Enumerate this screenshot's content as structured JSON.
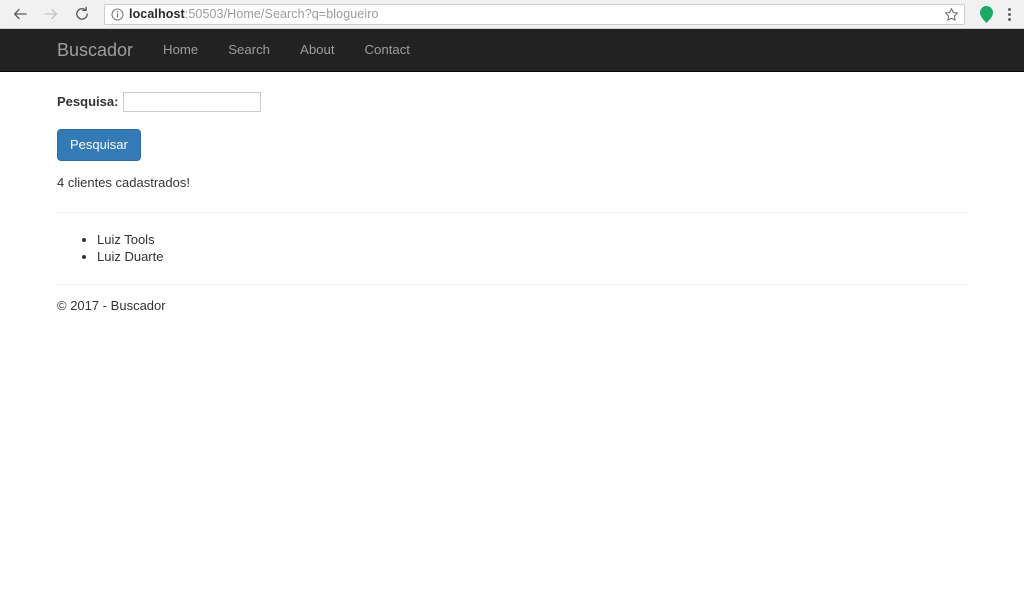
{
  "browser": {
    "back_label": "Back",
    "forward_label": "Forward",
    "reload_label": "Reload this page",
    "security_icon": "info-circle-icon",
    "url_host": "localhost",
    "url_rest": ":50503/Home/Search?q=blogueiro",
    "url_full": "localhost:50503/Home/Search?q=blogueiro",
    "star_label": "Bookmark this page",
    "extension_label": "extension-icon",
    "menu_label": "Customize and control Google Chrome",
    "extension_color": "#1aaa63"
  },
  "navbar": {
    "brand": "Buscador",
    "links": [
      {
        "label": "Home"
      },
      {
        "label": "Search"
      },
      {
        "label": "About"
      },
      {
        "label": "Contact"
      }
    ],
    "background": "#222222",
    "link_color": "#9d9d9d"
  },
  "main": {
    "search_label": "Pesquisa:",
    "search_value": "",
    "search_placeholder": "",
    "submit_label": "Pesquisar",
    "submit_color": "#337ab7",
    "status_text": "4 clientes cadastrados!",
    "results": [
      {
        "name": "Luiz Tools"
      },
      {
        "name": "Luiz Duarte"
      }
    ]
  },
  "footer": {
    "copyright": "© 2017 - Buscador"
  }
}
